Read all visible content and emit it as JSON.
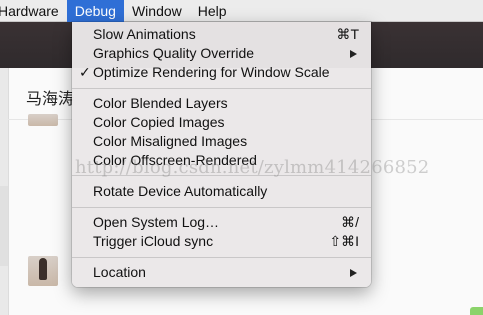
{
  "menubar": {
    "items": [
      "Hardware",
      "Debug",
      "Window",
      "Help"
    ],
    "active": "Debug"
  },
  "background": {
    "user_name": "马海涛"
  },
  "debug_menu": {
    "slow_animations": "Slow Animations",
    "slow_animations_shortcut": "⌘T",
    "graphics_quality": "Graphics Quality Override",
    "optimize_rendering": "Optimize Rendering for Window Scale",
    "optimize_rendering_check": "✓",
    "color_blended": "Color Blended Layers",
    "color_copied": "Color Copied Images",
    "color_misaligned": "Color Misaligned Images",
    "color_offscreen": "Color Offscreen-Rendered",
    "rotate_device": "Rotate Device Automatically",
    "open_system_log": "Open System Log…",
    "open_system_log_shortcut": "⌘/",
    "trigger_icloud": "Trigger iCloud sync",
    "trigger_icloud_shortcut": "⇧⌘I",
    "location": "Location"
  },
  "watermark": "http://blog.csdn.net/zylmm414266852",
  "colors": {
    "menubar_highlight": "#2f6fd6",
    "menu_background": "#eae7e8"
  }
}
